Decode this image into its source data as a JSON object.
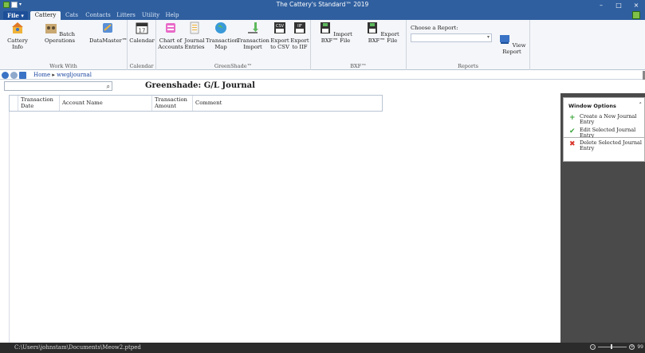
{
  "window": {
    "title": "The Cattery's Standard™ 2019",
    "minimize_label": "–",
    "maximize_label": "□",
    "close_label": "×"
  },
  "quick_access": {
    "dropdown_glyph": "▾"
  },
  "ribbon_tabs": {
    "file": "File ▾",
    "cattery": "Cattery",
    "cats": "Cats",
    "contacts": "Contacts",
    "litters": "Litters",
    "utility": "Utility",
    "help": "Help"
  },
  "ribbon": {
    "work_with": {
      "label": "Work With",
      "cattery_info": "Cattery Info",
      "batch_operations": "Batch Operations",
      "datamaster": "DataMaster™"
    },
    "calendar": {
      "label": "Calendar",
      "calendar": "Calendar",
      "calendar_icon_text": "17"
    },
    "greenshade": {
      "label": "GreenShade™",
      "chart_of_accounts": "Chart of Accounts",
      "journal_entries": "Journal Entries",
      "transaction_map": "Transaction Map",
      "transaction_import": "Transaction Import",
      "export_csv": "Export to CSV",
      "export_iif": "Export to IIF",
      "csv_icon_text": "CSV",
      "iif_icon_text": "IIF"
    },
    "bxf": {
      "label": "BXF™",
      "import_bxf": "Import BXF™ File",
      "export_bxf": "Export BXF™ File"
    },
    "reports": {
      "label": "Reports",
      "choose_report_label": "Choose a Report:",
      "report_value": "",
      "view_report": "View Report"
    }
  },
  "breadcrumb": {
    "home": "Home",
    "separator": "▸",
    "current": "wwgljournal"
  },
  "search": {
    "value": "",
    "icon": "⌕"
  },
  "page_title": "Greenshade: G/L Journal",
  "grid": {
    "columns": [
      "Transaction Date",
      "Account Name",
      "Transaction Amount",
      "Comment"
    ]
  },
  "window_options": {
    "title": "Window Options",
    "collapse_glyph": "˄",
    "items": [
      {
        "label": "Create a New Journal Entry",
        "icon": "plus-icon",
        "glyph": "+",
        "color": "#3aa53a"
      },
      {
        "label": "Edit Selected Journal Entry",
        "icon": "check-icon",
        "glyph": "✔",
        "color": "#3aa53a"
      },
      {
        "label": "Delete Selected Journal Entry",
        "icon": "delete-icon",
        "glyph": "✖",
        "color": "#d9342b"
      }
    ]
  },
  "status_bar": {
    "file_path": "C:\\Users\\johnstam\\Documents\\Meow2.ptped",
    "zoom_out": "–",
    "zoom_in": "+",
    "zoom_value": "99"
  },
  "colors": {
    "titlebar": "#2f5f9f",
    "ribbon_bg": "#f4f6f9",
    "right_panel": "#4a4a4a",
    "status_bar": "#2b2b2b"
  }
}
